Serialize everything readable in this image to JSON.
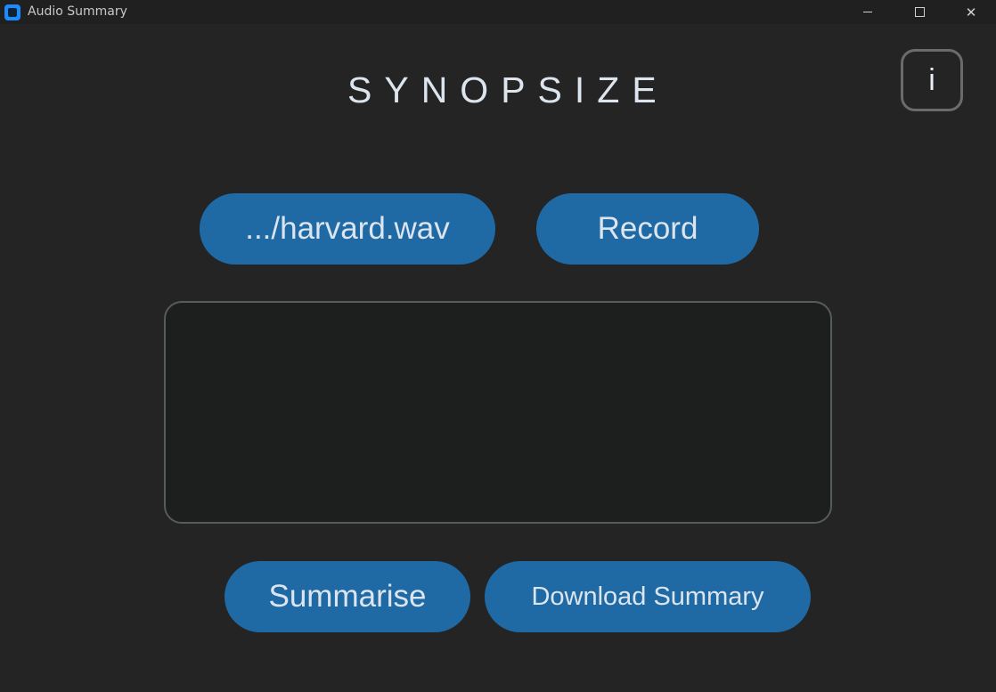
{
  "window": {
    "title": "Audio Summary"
  },
  "app": {
    "title": "SYNOPSIZE",
    "info_label": "i"
  },
  "controls": {
    "file_label": ".../harvard.wav",
    "record_label": "Record",
    "summarise_label": "Summarise",
    "download_label": "Download Summary"
  },
  "summary": {
    "text": ""
  },
  "colors": {
    "background": "#242424",
    "button": "#1f6aa5",
    "text": "#dce4ee",
    "textbox_bg": "#1d1e1e",
    "textbox_border": "#565b5e"
  }
}
